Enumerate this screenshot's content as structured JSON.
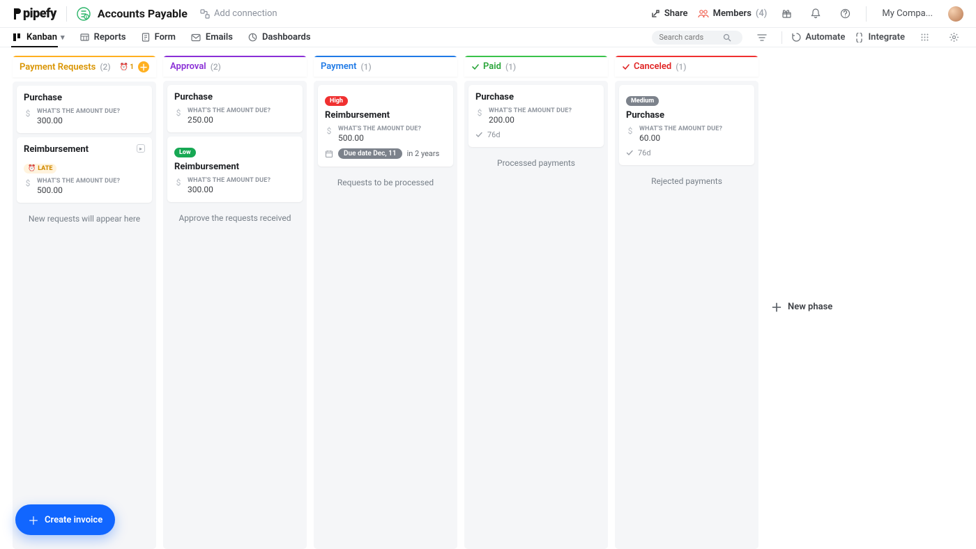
{
  "header": {
    "logo_text": "pipefy",
    "pipe_title": "Accounts Payable",
    "add_connection": "Add connection",
    "share": "Share",
    "members": "Members",
    "members_count": "(4)",
    "company": "My Compa..."
  },
  "tabs": {
    "kanban": "Kanban",
    "reports": "Reports",
    "form": "Form",
    "emails": "Emails",
    "dashboards": "Dashboards",
    "search_placeholder": "Search cards",
    "automate": "Automate",
    "integrate": "Integrate"
  },
  "columns": {
    "c0": {
      "name": "Payment Requests",
      "count": "(2)",
      "color": "#ffb020",
      "title_color": "#d99400",
      "alarm": "1",
      "footer": "New requests will appear here"
    },
    "c1": {
      "name": "Approval",
      "count": "(2)",
      "color": "#8a2fd6",
      "title_color": "#8a2fd6",
      "footer": "Approve the requests received"
    },
    "c2": {
      "name": "Payment",
      "count": "(1)",
      "color": "#1f7ae6",
      "title_color": "#1f7ae6",
      "footer": "Requests to be processed"
    },
    "c3": {
      "name": "Paid",
      "count": "(1)",
      "color": "#39c24a",
      "title_color": "#2aa53a",
      "footer": "Processed payments"
    },
    "c4": {
      "name": "Canceled",
      "count": "(1)",
      "color": "#f03030",
      "title_color": "#e02525",
      "footer": "Rejected payments"
    }
  },
  "field_label": "WHAT'S THE AMOUNT DUE?",
  "cards": {
    "c0a": {
      "title": "Purchase",
      "amount": "300.00"
    },
    "c0b": {
      "title": "Reimbursement",
      "amount": "500.00",
      "late": "LATE"
    },
    "c1a": {
      "title": "Purchase",
      "amount": "250.00"
    },
    "c1b": {
      "title": "Reimbursement",
      "amount": "300.00",
      "prio": "Low"
    },
    "c2a": {
      "title": "Reimbursement",
      "amount": "500.00",
      "prio": "High",
      "due_pill": "Due date Dec, 11",
      "due_rel": "in 2 years"
    },
    "c3a": {
      "title": "Purchase",
      "amount": "200.00",
      "time": "76d"
    },
    "c4a": {
      "title": "Purchase",
      "amount": "60.00",
      "prio": "Medium",
      "time": "76d"
    }
  },
  "new_phase": "New phase",
  "fab": "Create invoice"
}
